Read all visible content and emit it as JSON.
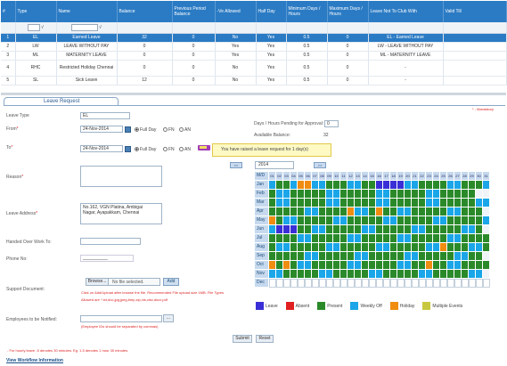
{
  "leave_table": {
    "headers": [
      "#",
      "Type",
      "Name",
      "Balance",
      "Previous Period Balance",
      "-Ve Allowed",
      "Half Day",
      "Minimum Days / Hours",
      "Maximum Days / Hours",
      "Leave Not To Club With",
      "Valid Till"
    ],
    "filter_checkmark": "√",
    "rows": [
      {
        "num": "1",
        "type": "EL",
        "name": "Earned Leave",
        "balance": "32",
        "prev": "0",
        "neg": "No",
        "half": "Yes",
        "min": "0.5",
        "max": "0",
        "club": "EL - Earned Leave",
        "valid": ""
      },
      {
        "num": "2",
        "type": "LW",
        "name": "LEAVE WITHOUT PAY",
        "balance": "0",
        "prev": "0",
        "neg": "Yes",
        "half": "Yes",
        "min": "0.5",
        "max": "0",
        "club": "LW - LEAVE WITHOUT PAY",
        "valid": ""
      },
      {
        "num": "3",
        "type": "ML",
        "name": "MATERNITY LEAVE",
        "balance": "0",
        "prev": "0",
        "neg": "Yes",
        "half": "Yes",
        "min": "0.5",
        "max": "0",
        "club": "ML - MATERNITY LEAVE",
        "valid": ""
      },
      {
        "num": "4",
        "type": "RHC",
        "name": "Restricted Holiday Chennai",
        "balance": "0",
        "prev": "0",
        "neg": "No",
        "half": "Yes",
        "min": "0.5",
        "max": "0",
        "club": "-",
        "valid": ""
      },
      {
        "num": "5",
        "type": "SL",
        "name": "Sick Leave",
        "balance": "12",
        "prev": "0",
        "neg": "No",
        "half": "Yes",
        "min": "0.5",
        "max": "0",
        "club": "-",
        "valid": ""
      }
    ]
  },
  "request": {
    "tab_title": "Leave Request",
    "mandatory_note": "* - Mandatory",
    "leave_type_label": "Leave Type",
    "leave_type_value": "EL",
    "from_label": "From",
    "from_value": "24-Nov-2014",
    "to_label": "To",
    "to_value": "24-Nov-2014",
    "full_day": "Full Day",
    "fn": "FN",
    "an": "AN",
    "days_pending_label": "Days / Hours Pending for Approval",
    "days_pending_value": "0",
    "available_label": "Available Balance:",
    "available_value": "32",
    "tooltip": "You have raised a leave request for 1 day(s)",
    "reason_label": "Reason",
    "address_label": "Leave Address",
    "address_value": "No.162, VGN Platina, Ambigai\nNagar, Ayapakkam, Chennai",
    "handover_label": "Handed Over Work To:",
    "phone_label": "Phone No:",
    "phone_value": "__________",
    "support_label": "Support Document:",
    "browse": "Browse...",
    "no_file": "No file selected.",
    "add": "Add",
    "upload_note_1": "Click on Add/Upload after browse the file. Recommended File upload size 1MB. File Types",
    "upload_note_2": "Allowed are *.txt,doc,jpg,jpeg,bmp,zip,xls,xlsx,docx,pdf",
    "notify_label": "Employees to be Notified:",
    "notify_btn": "...",
    "notify_note": "(Employee IDs should be separated by commas)",
    "submit": "Submit",
    "reset": "Reset",
    "hourly_note": "- For hourly leave -5 denotes 30 minutes. Eg. 1.5 denotes 1 hour 30 minutes",
    "workflow_link": "View Workflow Information"
  },
  "calendar": {
    "prev": "<<",
    "next": ">>",
    "year": "2014",
    "corner": "M/D",
    "months": [
      "Jan",
      "Feb",
      "Mar",
      "Apr",
      "May",
      "Jun",
      "Jul",
      "Aug",
      "Sep",
      "Oct",
      "Nov",
      "Dec"
    ],
    "colors": {
      "L": "#3a2fd6",
      "A": "#e02020",
      "P": "#2a8a2a",
      "W": "#1aa6e8",
      "H": "#f08c10",
      "M": "#c8c840",
      "E": "#ffffff",
      "B": "#f0f4f8"
    },
    "rows": [
      "WPPWHHWWPPPWWPPLLLLWWPPPPWWPPPW",
      "PWWPPPPPWWPPPPPWWPPPPPWWPPPPPBB",
      "PWWPPPPPWWPPPPPWWPPPPPWWPPPPPWW",
      "PPPPPWWPPPPHWWPHPPWWPPPPPWWPPPB",
      "HPWWPPPPPWWPPPPPWWPPPPPWWPPPPPW",
      "WLLLPPWWPPPPPWWPPPPPWWPPPPPWWPB",
      "PPPPWWPPPPPWWPPPPPWWPPPPPWWPPPP",
      "PWWPPPPPWWPPPPPWWPPPPPWWHPPPWWP",
      "PPPPPWWPPPPPWWPPPPPWWPPPPPWWPPB",
      "HPHPWWPPPPPWWPPPPPWWPPHPPWWPPPP",
      "WWPPPPPWWPPPPPWWPPPPPWWPPPPPWWB",
      "EEEEEEEEEEEEEEEEEEEEEEEEEEEEEEE"
    ]
  },
  "legend": [
    {
      "label": "Leave",
      "color": "#3a2fd6"
    },
    {
      "label": "Absent",
      "color": "#e02020"
    },
    {
      "label": "Present",
      "color": "#2a8a2a"
    },
    {
      "label": "Weekly Off",
      "color": "#1aa6e8"
    },
    {
      "label": "Holiday",
      "color": "#f08c10"
    },
    {
      "label": "Multiple Events",
      "color": "#c8c840"
    }
  ]
}
